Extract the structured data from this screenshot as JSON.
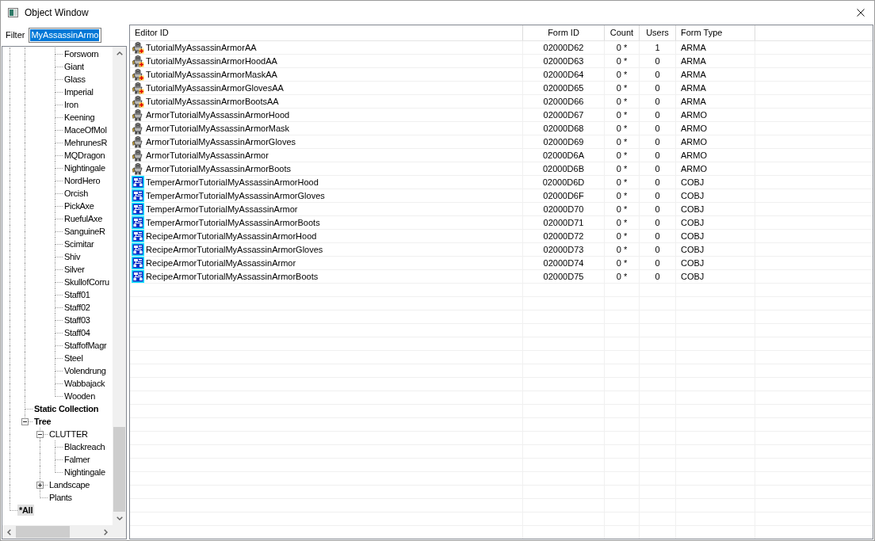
{
  "window": {
    "title": "Object Window"
  },
  "filter": {
    "label": "Filter",
    "value": "MyAssassinArmo",
    "highlighted": true
  },
  "tree": {
    "nodes": [
      {
        "children": [
          {
            "children": [
              {
                "children": [
                  {
                    "label": "Forsworn",
                    "bold": false,
                    "selected": false
                  },
                  {
                    "label": "Giant",
                    "bold": false,
                    "selected": false
                  },
                  {
                    "label": "Glass",
                    "bold": false,
                    "selected": false
                  },
                  {
                    "label": "Imperial",
                    "bold": false,
                    "selected": false
                  },
                  {
                    "label": "Iron",
                    "bold": false,
                    "selected": false
                  },
                  {
                    "label": "Keening",
                    "bold": false,
                    "selected": false
                  },
                  {
                    "label": "MaceOfMol",
                    "bold": false,
                    "selected": false
                  },
                  {
                    "label": "MehrunesR",
                    "bold": false,
                    "selected": false
                  },
                  {
                    "label": "MQDragon",
                    "bold": false,
                    "selected": false
                  },
                  {
                    "label": "Nightingale",
                    "bold": false,
                    "selected": false
                  },
                  {
                    "label": "NordHero",
                    "bold": false,
                    "selected": false
                  },
                  {
                    "label": "Orcish",
                    "bold": false,
                    "selected": false
                  },
                  {
                    "label": "PickAxe",
                    "bold": false,
                    "selected": false
                  },
                  {
                    "label": "RuefulAxe",
                    "bold": false,
                    "selected": false
                  },
                  {
                    "label": "SanguineR",
                    "bold": false,
                    "selected": false
                  },
                  {
                    "label": "Scimitar",
                    "bold": false,
                    "selected": false
                  },
                  {
                    "label": "Shiv",
                    "bold": false,
                    "selected": false
                  },
                  {
                    "label": "Silver",
                    "bold": false,
                    "selected": false
                  },
                  {
                    "label": "SkullofCorru",
                    "bold": false,
                    "selected": false
                  },
                  {
                    "label": "Staff01",
                    "bold": false,
                    "selected": false
                  },
                  {
                    "label": "Staff02",
                    "bold": false,
                    "selected": false
                  },
                  {
                    "label": "Staff03",
                    "bold": false,
                    "selected": false
                  },
                  {
                    "label": "Staff04",
                    "bold": false,
                    "selected": false
                  },
                  {
                    "label": "StaffofMagr",
                    "bold": false,
                    "selected": false
                  },
                  {
                    "label": "Steel",
                    "bold": false,
                    "selected": false
                  },
                  {
                    "label": "Volendrung",
                    "bold": false,
                    "selected": false
                  },
                  {
                    "label": "Wabbajack",
                    "bold": false,
                    "selected": false
                  },
                  {
                    "label": "Wooden",
                    "bold": false,
                    "selected": false
                  }
                ]
              }
            ]
          },
          {
            "label": "Static Collection",
            "bold": true,
            "selected": false
          },
          {
            "label": "Tree",
            "bold": true,
            "selected": false,
            "expanded": true,
            "children": [
              {
                "label": "CLUTTER",
                "bold": false,
                "selected": false,
                "expanded": true,
                "children": [
                  {
                    "label": "Blackreach",
                    "bold": false,
                    "selected": false
                  },
                  {
                    "label": "Falmer",
                    "bold": false,
                    "selected": false
                  },
                  {
                    "label": "Nightingale",
                    "bold": false,
                    "selected": false
                  }
                ]
              },
              {
                "label": "Landscape",
                "bold": false,
                "selected": false,
                "expanded": false
              },
              {
                "label": "Plants",
                "bold": false,
                "selected": false
              }
            ]
          }
        ]
      },
      {
        "label": "*All",
        "bold": true,
        "selected": true
      }
    ]
  },
  "table": {
    "columns": [
      "Editor ID",
      "Form ID",
      "Count",
      "Users",
      "Form Type"
    ],
    "rows": [
      {
        "kind": "addon",
        "editor_id": "TutorialMyAssassinArmorAA",
        "form_id": "02000D62",
        "count": "0 *",
        "users": "1",
        "form_type": "ARMA"
      },
      {
        "kind": "addon",
        "editor_id": "TutorialMyAssassinArmorHoodAA",
        "form_id": "02000D63",
        "count": "0 *",
        "users": "0",
        "form_type": "ARMA"
      },
      {
        "kind": "addon",
        "editor_id": "TutorialMyAssassinArmorMaskAA",
        "form_id": "02000D64",
        "count": "0 *",
        "users": "0",
        "form_type": "ARMA"
      },
      {
        "kind": "addon",
        "editor_id": "TutorialMyAssassinArmorGlovesAA",
        "form_id": "02000D65",
        "count": "0 *",
        "users": "0",
        "form_type": "ARMA"
      },
      {
        "kind": "addon",
        "editor_id": "TutorialMyAssassinArmorBootsAA",
        "form_id": "02000D66",
        "count": "0 *",
        "users": "0",
        "form_type": "ARMA"
      },
      {
        "kind": "armor",
        "editor_id": "ArmorTutorialMyAssassinArmorHood",
        "form_id": "02000D67",
        "count": "0 *",
        "users": "0",
        "form_type": "ARMO"
      },
      {
        "kind": "armor",
        "editor_id": "ArmorTutorialMyAssassinArmorMask",
        "form_id": "02000D68",
        "count": "0 *",
        "users": "0",
        "form_type": "ARMO"
      },
      {
        "kind": "armor",
        "editor_id": "ArmorTutorialMyAssassinArmorGloves",
        "form_id": "02000D69",
        "count": "0 *",
        "users": "0",
        "form_type": "ARMO"
      },
      {
        "kind": "armor",
        "editor_id": "ArmorTutorialMyAssassinArmor",
        "form_id": "02000D6A",
        "count": "0 *",
        "users": "0",
        "form_type": "ARMO"
      },
      {
        "kind": "armor",
        "editor_id": "ArmorTutorialMyAssassinArmorBoots",
        "form_id": "02000D6B",
        "count": "0 *",
        "users": "0",
        "form_type": "ARMO"
      },
      {
        "kind": "recipe",
        "editor_id": "TemperArmorTutorialMyAssassinArmorHood",
        "form_id": "02000D6D",
        "count": "0 *",
        "users": "0",
        "form_type": "COBJ"
      },
      {
        "kind": "recipe",
        "editor_id": "TemperArmorTutorialMyAssassinArmorGloves",
        "form_id": "02000D6F",
        "count": "0 *",
        "users": "0",
        "form_type": "COBJ"
      },
      {
        "kind": "recipe",
        "editor_id": "TemperArmorTutorialMyAssassinArmor",
        "form_id": "02000D70",
        "count": "0 *",
        "users": "0",
        "form_type": "COBJ"
      },
      {
        "kind": "recipe",
        "editor_id": "TemperArmorTutorialMyAssassinArmorBoots",
        "form_id": "02000D71",
        "count": "0 *",
        "users": "0",
        "form_type": "COBJ"
      },
      {
        "kind": "recipe",
        "editor_id": "RecipeArmorTutorialMyAssassinArmorHood",
        "form_id": "02000D72",
        "count": "0 *",
        "users": "0",
        "form_type": "COBJ"
      },
      {
        "kind": "recipe",
        "editor_id": "RecipeArmorTutorialMyAssassinArmorGloves",
        "form_id": "02000D73",
        "count": "0 *",
        "users": "0",
        "form_type": "COBJ"
      },
      {
        "kind": "recipe",
        "editor_id": "RecipeArmorTutorialMyAssassinArmor",
        "form_id": "02000D74",
        "count": "0 *",
        "users": "0",
        "form_type": "COBJ"
      },
      {
        "kind": "recipe",
        "editor_id": "RecipeArmorTutorialMyAssassinArmorBoots",
        "form_id": "02000D75",
        "count": "0 *",
        "users": "0",
        "form_type": "COBJ"
      }
    ]
  }
}
